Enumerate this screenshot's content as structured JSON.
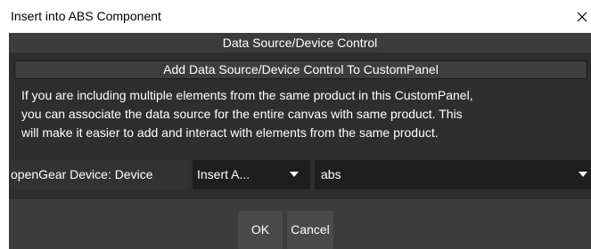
{
  "window": {
    "title": "Insert into ABS Component",
    "close_glyph": "close-icon"
  },
  "panel": {
    "section_title": "Data Source/Device Control",
    "subheader": "Add Data Source/Device Control To CustomPanel",
    "description": "If you are including multiple elements from the same product in this CustomPanel,\nyou can associate the data source for the entire canvas with same product.  This\nwill make it easier to add and interact with elements from the same product."
  },
  "device": {
    "label": "openGear Device: Device",
    "source_select_value": "Insert A...",
    "device_select_value": "abs"
  },
  "buttons": {
    "ok": "OK",
    "cancel": "Cancel"
  },
  "colors": {
    "panel_bg": "#2e2e2e",
    "header_bg": "#3c3c3c",
    "select_bg": "#1e1e1e",
    "button_bg": "#4a4a4a",
    "text": "#ffffff"
  }
}
